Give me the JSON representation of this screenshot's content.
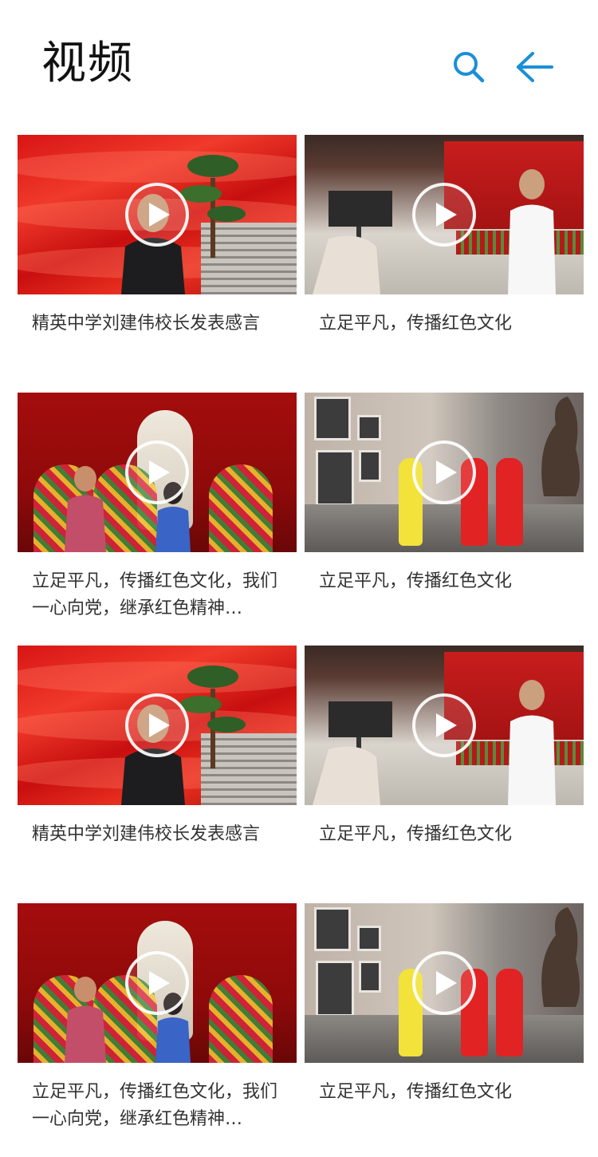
{
  "header": {
    "title": "视频",
    "search_icon": "search-icon",
    "back_icon": "arrow-left-icon",
    "accent_color": "#1a8fd6"
  },
  "videos": [
    {
      "caption": "精英中学刘建伟校长发表感言",
      "scene": "red-mountain-interview"
    },
    {
      "caption": "立足平凡，传播红色文化",
      "scene": "exhibition-hall-interview"
    },
    {
      "caption": "立足平凡，传播红色文化，我们一心向党，继承红色精神…",
      "scene": "memorial-statue"
    },
    {
      "caption": "立足平凡，传播红色文化",
      "scene": "gallery-visit"
    },
    {
      "caption": "精英中学刘建伟校长发表感言",
      "scene": "red-mountain-interview"
    },
    {
      "caption": "立足平凡，传播红色文化",
      "scene": "exhibition-hall-interview"
    },
    {
      "caption": "立足平凡，传播红色文化，我们一心向党，继承红色精神…",
      "scene": "memorial-statue"
    },
    {
      "caption": "立足平凡，传播红色文化",
      "scene": "gallery-visit"
    }
  ]
}
